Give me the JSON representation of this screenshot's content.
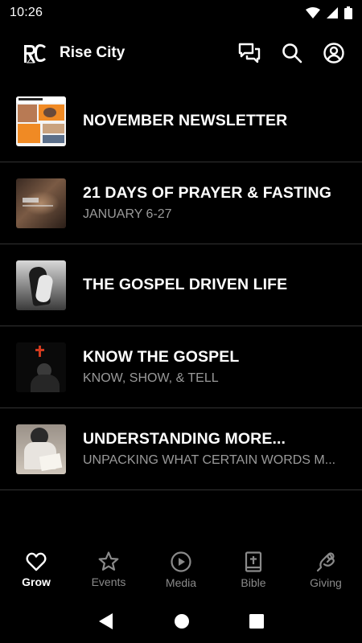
{
  "status_bar": {
    "time": "10:26",
    "icons": [
      "wifi-icon",
      "signal-icon",
      "battery-icon"
    ]
  },
  "header": {
    "title": "Rise City",
    "logo_text": "RC",
    "actions": [
      "chat-icon",
      "search-icon",
      "account-icon"
    ]
  },
  "feed": {
    "items": [
      {
        "title": "NOVEMBER NEWSLETTER",
        "subtitle": ""
      },
      {
        "title": "21 DAYS OF PRAYER & FASTING",
        "subtitle": "JANUARY 6-27"
      },
      {
        "title": "THE GOSPEL DRIVEN LIFE",
        "subtitle": ""
      },
      {
        "title": "KNOW THE GOSPEL",
        "subtitle": "KNOW, SHOW, & TELL"
      },
      {
        "title": "UNDERSTANDING MORE...",
        "subtitle": "UNPACKING WHAT CERTAIN WORDS M..."
      }
    ]
  },
  "bottom_nav": {
    "items": [
      {
        "label": "Grow",
        "icon": "heart-icon",
        "active": true
      },
      {
        "label": "Events",
        "icon": "star-icon",
        "active": false
      },
      {
        "label": "Media",
        "icon": "play-icon",
        "active": false
      },
      {
        "label": "Bible",
        "icon": "bible-icon",
        "active": false
      },
      {
        "label": "Giving",
        "icon": "giving-icon",
        "active": false
      }
    ]
  },
  "colors": {
    "background": "#000000",
    "text_primary": "#ffffff",
    "text_secondary": "#9a9a9a",
    "divider": "#333333",
    "nav_inactive": "#8a8a8a"
  }
}
